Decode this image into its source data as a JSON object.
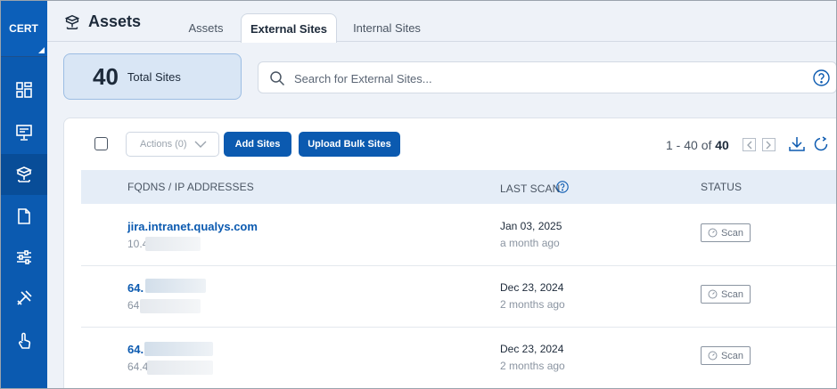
{
  "sidebar": {
    "brand": "CERT",
    "items": [
      {
        "icon": "dashboard-icon"
      },
      {
        "icon": "monitor-icon"
      },
      {
        "icon": "assets-network-icon",
        "active": true
      },
      {
        "icon": "document-icon"
      },
      {
        "icon": "sliders-icon"
      },
      {
        "icon": "tools-icon"
      },
      {
        "icon": "pointer-hand-icon"
      }
    ]
  },
  "header": {
    "title": "Assets",
    "tabs": [
      {
        "label": "Assets"
      },
      {
        "label": "External Sites",
        "active": true
      },
      {
        "label": "Internal Sites"
      }
    ]
  },
  "summary": {
    "total_value": "40",
    "total_label": "Total Sites"
  },
  "search": {
    "placeholder": "Search for External Sites...",
    "value": ""
  },
  "toolbar": {
    "actions_label": "Actions (0)",
    "add_sites_label": "Add Sites",
    "upload_bulk_label": "Upload Bulk Sites",
    "pager_range": "1 - 40 of",
    "pager_total": "40"
  },
  "table": {
    "columns": [
      "FQDNS / IP ADDRESSES",
      "LAST SCAN",
      "STATUS"
    ],
    "rows": [
      {
        "fqdn": "jira.intranet.qualys.com",
        "ip": "10.4",
        "last_scan_date": "Jan 03, 2025",
        "last_scan_relative": "a month ago",
        "status_label": "Scan"
      },
      {
        "fqdn": "64.",
        "ip": "64.",
        "last_scan_date": "Dec 23, 2024",
        "last_scan_relative": "2 months ago",
        "status_label": "Scan"
      },
      {
        "fqdn": "64.",
        "ip": "64.4",
        "last_scan_date": "Dec 23, 2024",
        "last_scan_relative": "2 months ago",
        "status_label": "Scan"
      }
    ]
  },
  "colors": {
    "brand_blue": "#0b5ab0",
    "sidebar": "#0b5ab0",
    "summary_card": "#d9e6f5"
  }
}
